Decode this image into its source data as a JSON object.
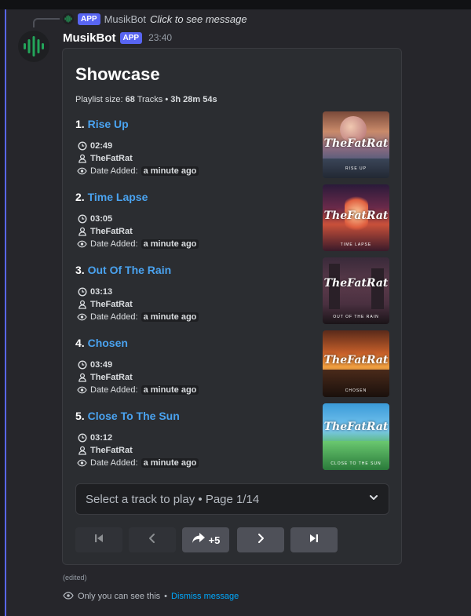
{
  "colors": {
    "accent": "#5865f2",
    "link": "#4aa3f0",
    "bot_green": "#23a55a",
    "embed_bg": "#2b2d31"
  },
  "reply": {
    "app_tag": "APP",
    "name": "MusikBot",
    "text": "Click to see message",
    "icon": "equalizer-icon"
  },
  "message": {
    "author": "MusikBot",
    "app_tag": "APP",
    "time": "23:40",
    "avatar_icon": "equalizer-icon",
    "edited": "(edited)"
  },
  "embed": {
    "title": "Showcase",
    "size_label": "Playlist size:",
    "size_count": "68",
    "size_unit": "Tracks",
    "separator": "•",
    "duration": "3h 28m 54s",
    "date_label": "Date Added:",
    "tracks": [
      {
        "num": "1.",
        "title": "Rise Up",
        "duration": "02:49",
        "artist": "TheFatRat",
        "added": "a minute ago",
        "cover_brand": "TheFatRat",
        "cover_sub": "RISE UP"
      },
      {
        "num": "2.",
        "title": "Time Lapse",
        "duration": "03:05",
        "artist": "TheFatRat",
        "added": "a minute ago",
        "cover_brand": "TheFatRat",
        "cover_sub": "TIME LAPSE"
      },
      {
        "num": "3.",
        "title": "Out Of The Rain",
        "duration": "03:13",
        "artist": "TheFatRat",
        "added": "a minute ago",
        "cover_brand": "TheFatRat",
        "cover_sub": "OUT OF THE RAIN"
      },
      {
        "num": "4.",
        "title": "Chosen",
        "duration": "03:49",
        "artist": "TheFatRat",
        "added": "a minute ago",
        "cover_brand": "TheFatRat",
        "cover_sub": "CHOSEN"
      },
      {
        "num": "5.",
        "title": "Close To The Sun",
        "duration": "03:12",
        "artist": "TheFatRat",
        "added": "a minute ago",
        "cover_brand": "TheFatRat",
        "cover_sub": "CLOSE TO THE SUN"
      }
    ]
  },
  "select": {
    "placeholder": "Select a track to play • Page 1/14",
    "icon": "chevron-down-icon"
  },
  "buttons": {
    "first": {
      "icon": "skip-to-start-icon",
      "enabled": false
    },
    "prev": {
      "icon": "chevron-left-icon",
      "enabled": false
    },
    "jump": {
      "icon": "forward-arrow-icon",
      "label": "+5",
      "enabled": true
    },
    "next": {
      "icon": "chevron-right-icon",
      "enabled": true
    },
    "last": {
      "icon": "skip-to-end-icon",
      "enabled": true
    }
  },
  "ephemeral": {
    "text": "Only you can see this",
    "separator": "•",
    "dismiss": "Dismiss message",
    "icon": "eye-icon"
  }
}
